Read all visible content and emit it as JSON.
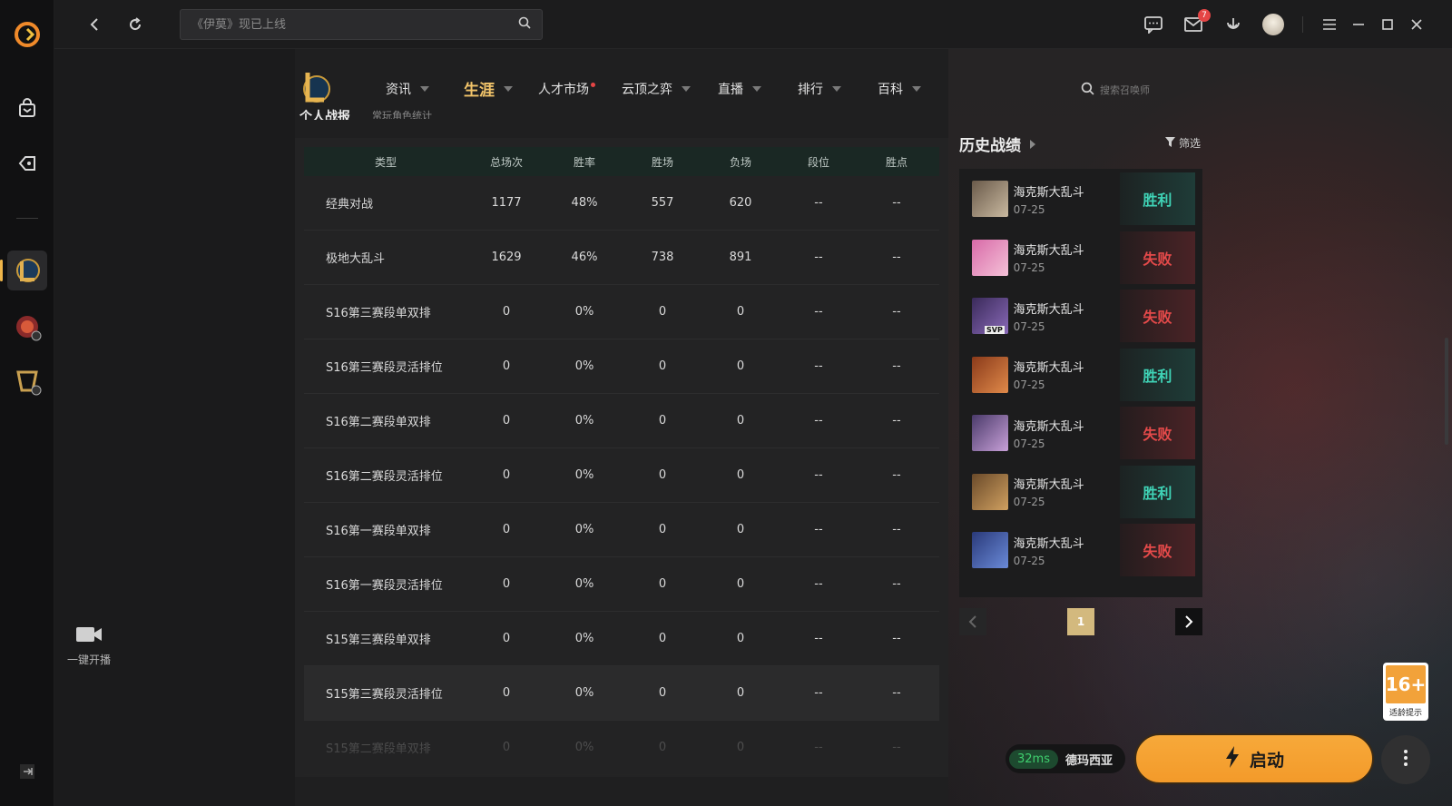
{
  "topbar": {
    "search_placeholder": "《伊莫》现已上线",
    "mail_count": "7"
  },
  "sidebar": {
    "stream_label": "一键开播"
  },
  "game_nav": {
    "items": [
      {
        "label": "资讯"
      },
      {
        "label": "生涯"
      },
      {
        "label": "人才市场"
      },
      {
        "label": "云顶之弈"
      },
      {
        "label": "直播"
      },
      {
        "label": "排行"
      },
      {
        "label": "百科"
      }
    ],
    "summoner_search_placeholder": "搜索召唤师"
  },
  "section": {
    "title": "个人战报",
    "subtitle": "常玩角色统计"
  },
  "stats_table": {
    "headers": [
      "类型",
      "总场次",
      "胜率",
      "胜场",
      "负场",
      "段位",
      "胜点"
    ],
    "rows": [
      [
        "经典对战",
        "1177",
        "48%",
        "557",
        "620",
        "--",
        "--"
      ],
      [
        "极地大乱斗",
        "1629",
        "46%",
        "738",
        "891",
        "--",
        "--"
      ],
      [
        "S16第三赛段单双排",
        "0",
        "0%",
        "0",
        "0",
        "--",
        "--"
      ],
      [
        "S16第三赛段灵活排位",
        "0",
        "0%",
        "0",
        "0",
        "--",
        "--"
      ],
      [
        "S16第二赛段单双排",
        "0",
        "0%",
        "0",
        "0",
        "--",
        "--"
      ],
      [
        "S16第二赛段灵活排位",
        "0",
        "0%",
        "0",
        "0",
        "--",
        "--"
      ],
      [
        "S16第一赛段单双排",
        "0",
        "0%",
        "0",
        "0",
        "--",
        "--"
      ],
      [
        "S16第一赛段灵活排位",
        "0",
        "0%",
        "0",
        "0",
        "--",
        "--"
      ],
      [
        "S15第三赛段单双排",
        "0",
        "0%",
        "0",
        "0",
        "--",
        "--"
      ],
      [
        "S15第三赛段灵活排位",
        "0",
        "0%",
        "0",
        "0",
        "--",
        "--"
      ],
      [
        "S15第二赛段单双排",
        "0",
        "0%",
        "0",
        "0",
        "--",
        "--"
      ]
    ]
  },
  "history": {
    "title": "历史战绩",
    "filter_label": "筛选",
    "matches": [
      {
        "mode": "海克斯大乱斗",
        "date": "07-25",
        "result": "胜利",
        "win": true
      },
      {
        "mode": "海克斯大乱斗",
        "date": "07-25",
        "result": "失败",
        "win": false
      },
      {
        "mode": "海克斯大乱斗",
        "date": "07-25",
        "result": "失败",
        "win": false,
        "badge": "SVP"
      },
      {
        "mode": "海克斯大乱斗",
        "date": "07-25",
        "result": "胜利",
        "win": true
      },
      {
        "mode": "海克斯大乱斗",
        "date": "07-25",
        "result": "失败",
        "win": false
      },
      {
        "mode": "海克斯大乱斗",
        "date": "07-25",
        "result": "胜利",
        "win": true
      },
      {
        "mode": "海克斯大乱斗",
        "date": "07-25",
        "result": "失败",
        "win": false
      }
    ],
    "current_page": "1"
  },
  "age_rating": {
    "rating": "16+",
    "label": "适龄提示"
  },
  "launch": {
    "ping": "32ms",
    "server": "德玛西亚",
    "button_label": "启动"
  },
  "colors": {
    "accent": "#f2c46a",
    "win": "#3fd3b6",
    "lose": "#e54a4a",
    "launch": "#f7a93a"
  }
}
